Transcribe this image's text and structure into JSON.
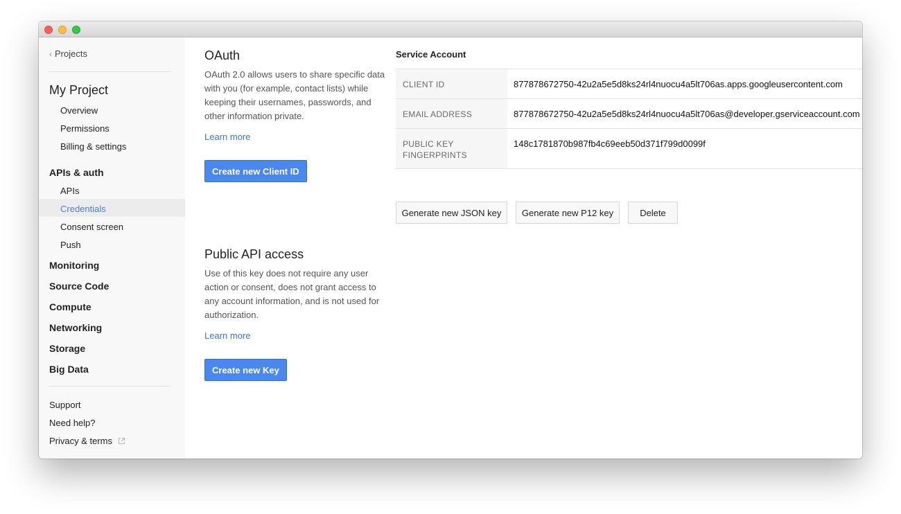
{
  "sidebar": {
    "back_label": "Projects",
    "project_name": "My Project",
    "project_items": [
      "Overview",
      "Permissions",
      "Billing & settings"
    ],
    "apis_heading": "APIs & auth",
    "apis_items": [
      "APIs",
      "Credentials",
      "Consent screen",
      "Push"
    ],
    "active_item": "Credentials",
    "sections": [
      "Monitoring",
      "Source Code",
      "Compute",
      "Networking",
      "Storage",
      "Big Data"
    ],
    "footer": {
      "support": "Support",
      "help": "Need help?",
      "privacy": "Privacy & terms",
      "privacy_icon": "external-link-icon"
    }
  },
  "oauth": {
    "title": "OAuth",
    "description": "OAuth 2.0 allows users to share specific data with you (for example, contact lists) while keeping their usernames, passwords, and other information private.",
    "learn_more": "Learn more",
    "button": "Create new Client ID"
  },
  "public_api": {
    "title": "Public API access",
    "description": "Use of this key does not require any user action or consent, does not grant access to any account information, and is not used for authorization.",
    "learn_more": "Learn more",
    "button": "Create new Key"
  },
  "service_account": {
    "title": "Service Account",
    "rows": [
      {
        "label": "CLIENT ID",
        "value": "877878672750-42u2a5e5d8ks24rl4nuocu4a5lt706as.apps.googleusercontent.com"
      },
      {
        "label": "EMAIL ADDRESS",
        "value": "877878672750-42u2a5e5d8ks24rl4nuocu4a5lt706as@developer.gserviceaccount.com"
      },
      {
        "label": "PUBLIC KEY FINGERPRINTS",
        "value": "148c1781870b987fb4c69eeb50d371f799d0099f"
      }
    ],
    "buttons": {
      "json": "Generate new JSON key",
      "p12": "Generate new P12 key",
      "delete": "Delete"
    }
  },
  "colors": {
    "accent": "#4a87ee",
    "link": "#3b74d6",
    "active_nav": "#4a7ed8",
    "sidebar_bg": "#f8f8f8"
  }
}
